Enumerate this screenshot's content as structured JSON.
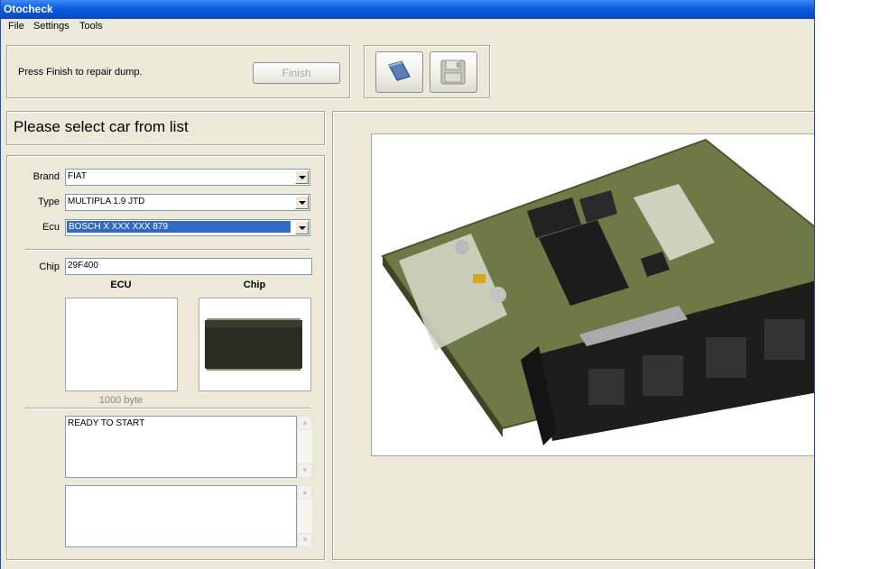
{
  "window": {
    "title": "Otocheck"
  },
  "menu": {
    "file": "File",
    "settings": "Settings",
    "tools": "Tools"
  },
  "toolbar": {
    "message": "Press Finish to repair dump.",
    "finish_label": "Finish"
  },
  "header": {
    "prompt": "Please select car from list"
  },
  "form": {
    "brand_label": "Brand",
    "brand_value": "FIAT",
    "type_label": "Type",
    "type_value": "MULTIPLA 1.9 JTD",
    "ecu_label": "Ecu",
    "ecu_value": "BOSCH X XXX XXX 879",
    "chip_label": "Chip",
    "chip_value": "29F400"
  },
  "images": {
    "ecu_heading": "ECU",
    "chip_heading": "Chip",
    "size_text": "1000 byte"
  },
  "log": {
    "status_text": "READY TO START",
    "second_text": ""
  },
  "colors": {
    "titlebar": "#0b5be0",
    "selection": "#316ac5",
    "panel": "#ece9d8",
    "pcb_green": "#6e7a45"
  }
}
